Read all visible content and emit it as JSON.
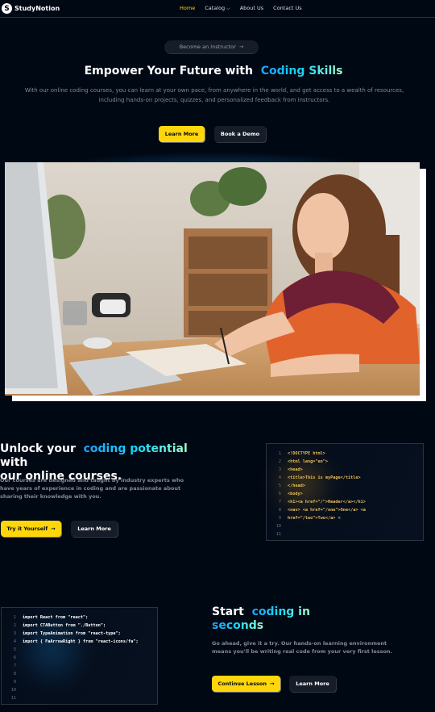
{
  "nav": {
    "logo_glyph": "S",
    "brand": "StudyNotion",
    "links": [
      {
        "label": "Home",
        "active": true
      },
      {
        "label": "Catalog",
        "has_dropdown": true
      },
      {
        "label": "About Us"
      },
      {
        "label": "Contact Us"
      }
    ]
  },
  "hero": {
    "pill_label": "Become an Instructor",
    "title_prefix": "Empower Your Future with",
    "title_highlight": "Coding Skills",
    "subtitle": "With our online coding courses, you can learn at your own pace, from anywhere in the world, and get access to a wealth of resources, including hands-on projects, quizzes, and personalized feedback from instructors.",
    "learn_more": "Learn More",
    "book_demo": "Book a Demo"
  },
  "block1": {
    "title_prefix": "Unlock your",
    "title_highlight": "coding potential",
    "title_suffix_1": "with",
    "title_suffix_2": "our online courses.",
    "desc": "Our courses are designed and taught by industry experts who have years of experience in coding and are passionate about sharing their knowledge with you.",
    "btn_primary": "Try it Yourself",
    "btn_secondary": "Learn More",
    "code_lines": [
      "1",
      "2",
      "3",
      "4",
      "5",
      "6",
      "7",
      "8",
      "9",
      "10",
      "11"
    ],
    "code": "<!DOCTYPE html>\n<html lang=\"en\">\n<head>\n<title>This is myPage</title>\n</head>\n<body>\n<h1><a href=\"/\">Header</a></h1>\n<nav> <a href=\"/one\">One</a> <a\nhref=\"/two\">Two</a> <",
    "code_color": "#e7bc5b"
  },
  "block2": {
    "title_prefix": "Start",
    "title_highlight_1": "coding in",
    "title_highlight_2": "seconds",
    "desc": "Go ahead, give it a try. Our hands-on learning environment means you'll be writing real code from your very first lesson.",
    "btn_primary": "Continue Lesson",
    "btn_secondary": "Learn More",
    "code_lines": [
      "1",
      "2",
      "3",
      "4",
      "5",
      "6",
      "7",
      "8",
      "9",
      "10",
      "11"
    ],
    "code": "import React from \"react\";\nimport CTAButton from \"./Button\";\nimport TypeAnimation from \"react-type\";\nimport { FaArrowRight } from \"react-icons/fa\";",
    "code_color": "#ffffff"
  },
  "colors": {
    "background": "#000814",
    "accent_yellow": "#ffd60a",
    "accent_blue": "#12d8fa"
  }
}
